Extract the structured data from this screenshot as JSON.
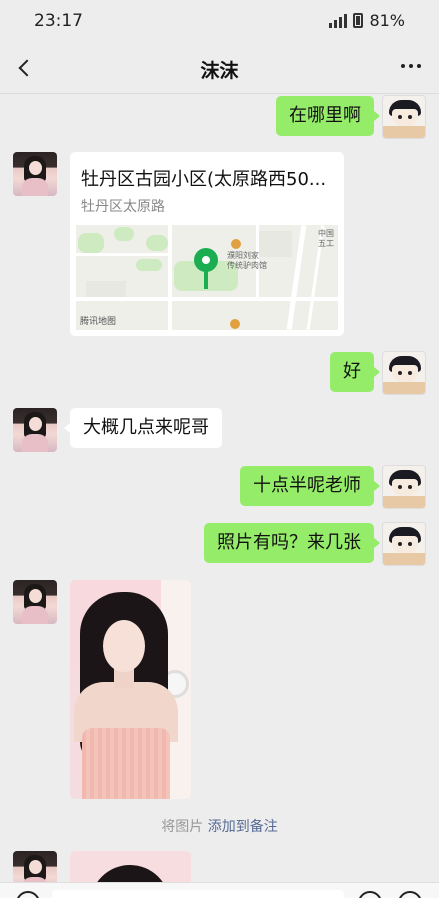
{
  "status_bar": {
    "time": "23:17",
    "battery": "81%"
  },
  "header": {
    "title": "沫沫"
  },
  "messages": [
    {
      "side": "right",
      "text": "在哪里啊"
    },
    {
      "side": "left",
      "type": "location",
      "title": "牡丹区古园小区(太原路西50...",
      "address": "牡丹区太原路"
    },
    {
      "side": "right",
      "text": "好"
    },
    {
      "side": "left",
      "text": "大概几点来呢哥"
    },
    {
      "side": "right",
      "text": "十点半呢老师"
    },
    {
      "side": "right",
      "text": "照片有吗？来几张"
    },
    {
      "side": "left",
      "type": "image"
    },
    {
      "side": "left",
      "type": "image"
    }
  ],
  "map": {
    "poi_label": "濮阳刘家 传统驴肉馆",
    "edge_label": "中国 五工",
    "provider": "腾讯地图"
  },
  "notice": {
    "prefix": "将图片",
    "link": "添加到备注"
  },
  "colors": {
    "self_bubble": "#95ec69",
    "other_bubble": "#ffffff",
    "background": "#ededed",
    "pin": "#1aad52",
    "link": "#576b95"
  }
}
